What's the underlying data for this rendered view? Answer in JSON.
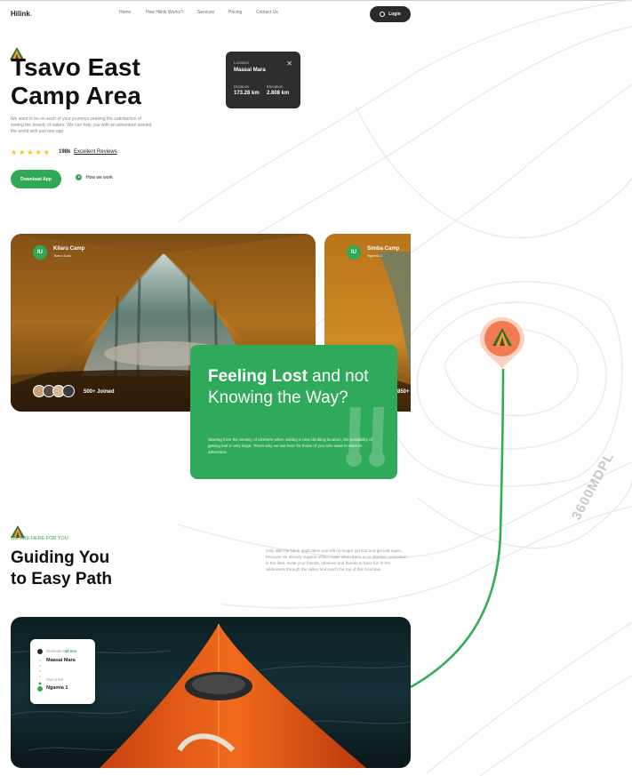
{
  "brand": {
    "name": "Hilink",
    "dot": "."
  },
  "nav": {
    "items": [
      "Home",
      "How Hilink Works?",
      "Services",
      "Pricing",
      "Contact Us"
    ],
    "login_label": "Login"
  },
  "hero": {
    "title_line1": "Tsavo East",
    "title_line2": "Camp Area",
    "description": "We want to be on each of your journeys seeking the satisfaction of seeing the beauty of nature. We can help you with an adventure around the world with just one app.",
    "stars": "★★★★★",
    "review_count": "198k",
    "review_link": "Excellent Reviews",
    "download_label": "Download App",
    "how_label": "How we work"
  },
  "location_card": {
    "location_label": "Location",
    "location_value": "Maasai Mara",
    "close_symbol": "✕",
    "distance_label": "Distance",
    "distance_value": "173.28 km",
    "elevation_label": "Elevation",
    "elevation_value": "2.808 km"
  },
  "camps": [
    {
      "pin": "IU",
      "title": "Kilaru Camp",
      "subtitle": "Tsavo East",
      "joined": "500+ Joined"
    },
    {
      "pin": "IU",
      "title": "Simba Camp",
      "subtitle": "Ngamia 1",
      "joined": "850+"
    }
  ],
  "feature": {
    "title_bold": "Feeling Lost",
    "title_rest": " and not Knowing the Way?",
    "body": "Starting from the anxiety of climbers when visiting a new climbing location, the possibility of getting lost is very large. That's why we are here for those of you who want to start an adventure."
  },
  "guide": {
    "kicker": "WE ARE HERE FOR YOU",
    "title_line1": "Guiding You",
    "title_line2": "to Easy Path",
    "description": "Only with the hilink application you will no longer get lost and get lost again, because we already support offline maps when there is no internet connection in the field. Invite your friends, relatives and friends to have fun in the wilderness through the valley and reach the top of the mountain"
  },
  "route_card": {
    "destination_label": "Destination",
    "duration": "48 min",
    "destination_value": "Maasai Mara",
    "start_label": "Start track",
    "start_value": "Ngamia 1"
  },
  "map_label": "3600MDPL",
  "colors": {
    "accent": "#30a955",
    "dark": "#2a2a2a",
    "pin": "#f27b52"
  }
}
